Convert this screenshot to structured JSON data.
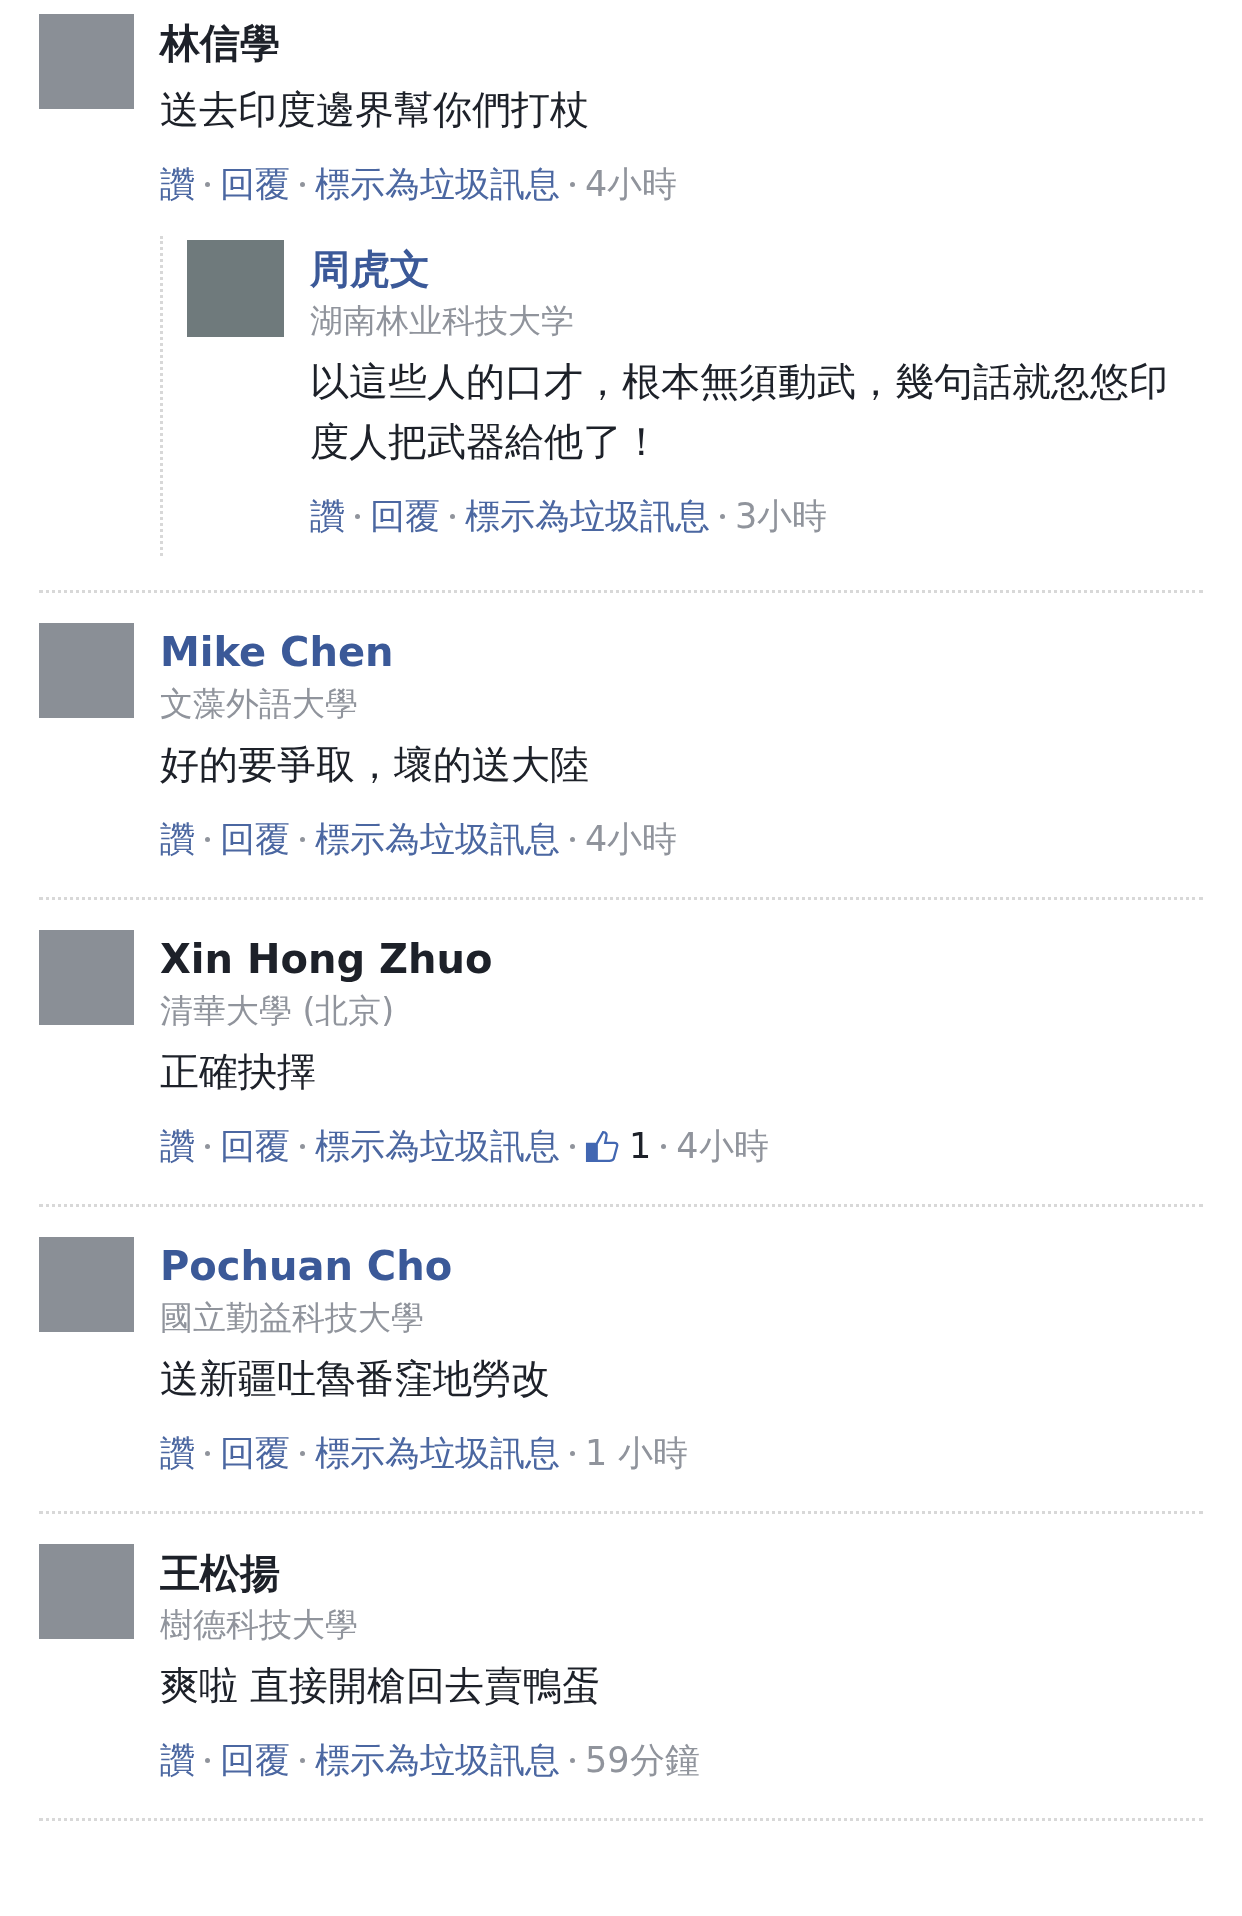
{
  "comments": [
    {
      "name": "林信學",
      "linked": false,
      "text": "送去印度邊界幫你們打杖",
      "actions": [
        "讚",
        "回覆",
        "標示為垃圾訊息"
      ],
      "time": "4小時",
      "replies": [
        {
          "name": "周虎文",
          "linked": true,
          "school": "湖南林业科技大学",
          "text": "以這些人的口才，根本無須動武，幾句話就忽悠印度人把武器給他了！",
          "actions": [
            "讚",
            "回覆",
            "標示為垃圾訊息"
          ],
          "time": "3小時"
        }
      ]
    },
    {
      "name": "Mike Chen",
      "linked": true,
      "school": "文藻外語大學",
      "text": "好的要爭取，壞的送大陸",
      "actions": [
        "讚",
        "回覆",
        "標示為垃圾訊息"
      ],
      "time": "4小時"
    },
    {
      "name": "Xin Hong Zhuo",
      "linked": false,
      "school": "清華大學 (北京)",
      "text": "正確抉擇",
      "actions": [
        "讚",
        "回覆",
        "標示為垃圾訊息"
      ],
      "likes": "1",
      "time": "4小時"
    },
    {
      "name": "Pochuan Cho",
      "linked": true,
      "school": "國立勤益科技大學",
      "text": "送新疆吐魯番窪地勞改",
      "actions": [
        "讚",
        "回覆",
        "標示為垃圾訊息"
      ],
      "time": "1 小時"
    },
    {
      "name": "王松揚",
      "linked": false,
      "school": "樹德科技大學",
      "text": "爽啦 直接開槍回去賣鴨蛋",
      "actions": [
        "讚",
        "回覆",
        "標示為垃圾訊息"
      ],
      "time": "59分鐘"
    }
  ]
}
